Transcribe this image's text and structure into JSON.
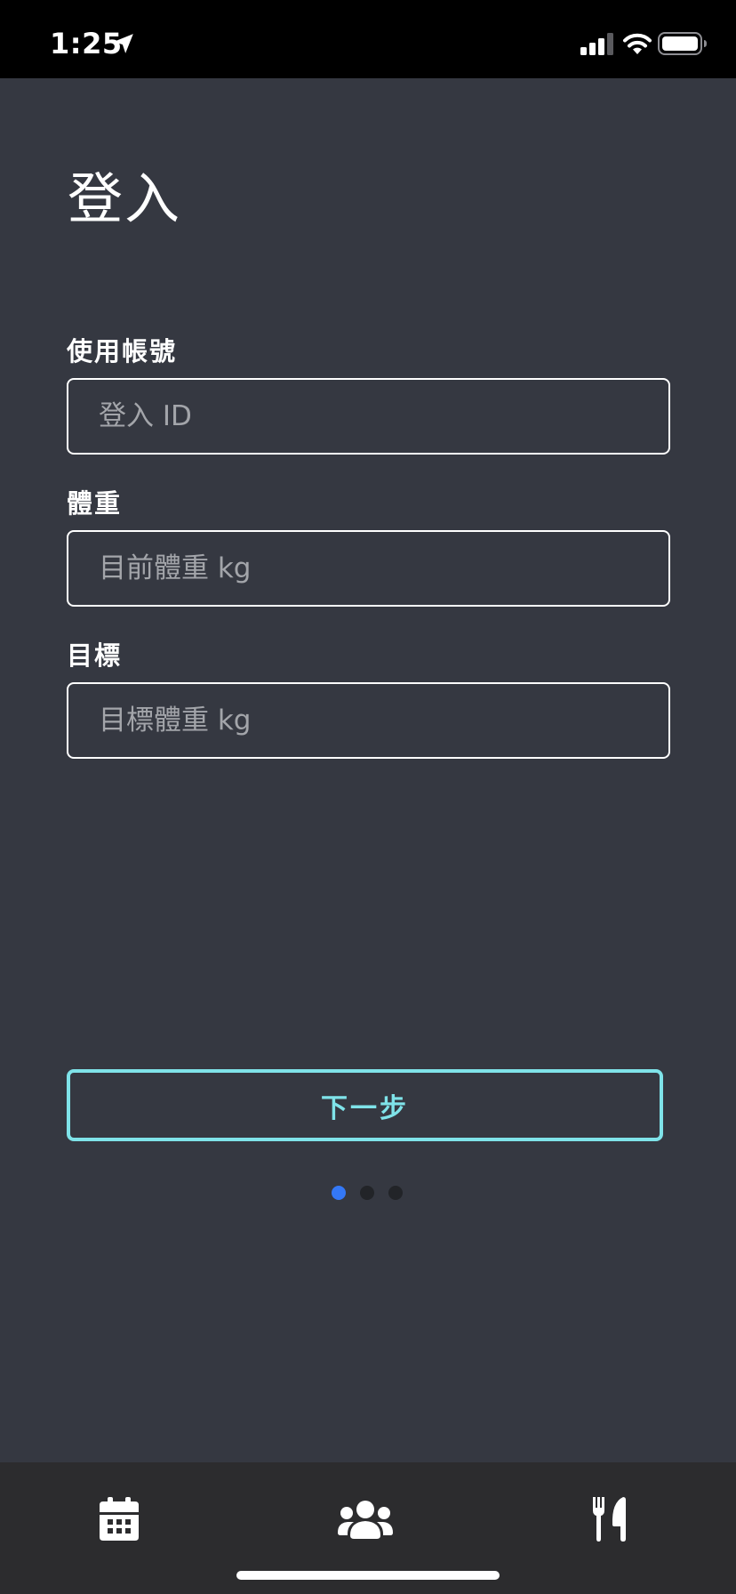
{
  "status_bar": {
    "time": "1:25",
    "icons": [
      "location-arrow-icon",
      "cellular-signal-icon",
      "wifi-icon",
      "battery-icon"
    ]
  },
  "login": {
    "title": "登入",
    "fields": [
      {
        "label": "使用帳號",
        "placeholder": "登入 ID",
        "value": ""
      },
      {
        "label": "體重",
        "placeholder": "目前體重 kg",
        "value": ""
      },
      {
        "label": "目標",
        "placeholder": "目標體重 kg",
        "value": ""
      }
    ],
    "next_button": "下一步"
  },
  "pagination": {
    "current_page": 1,
    "total_pages": 3
  },
  "tab_bar": {
    "items": [
      {
        "icon": "calendar-icon"
      },
      {
        "icon": "users-icon"
      },
      {
        "icon": "utensils-icon"
      }
    ]
  },
  "colors": {
    "background": "#353841",
    "status_bar": "#000000",
    "accent": "#7fe3e9",
    "active_dot": "#3478f6",
    "tab_bar": "#2c2c2e"
  }
}
